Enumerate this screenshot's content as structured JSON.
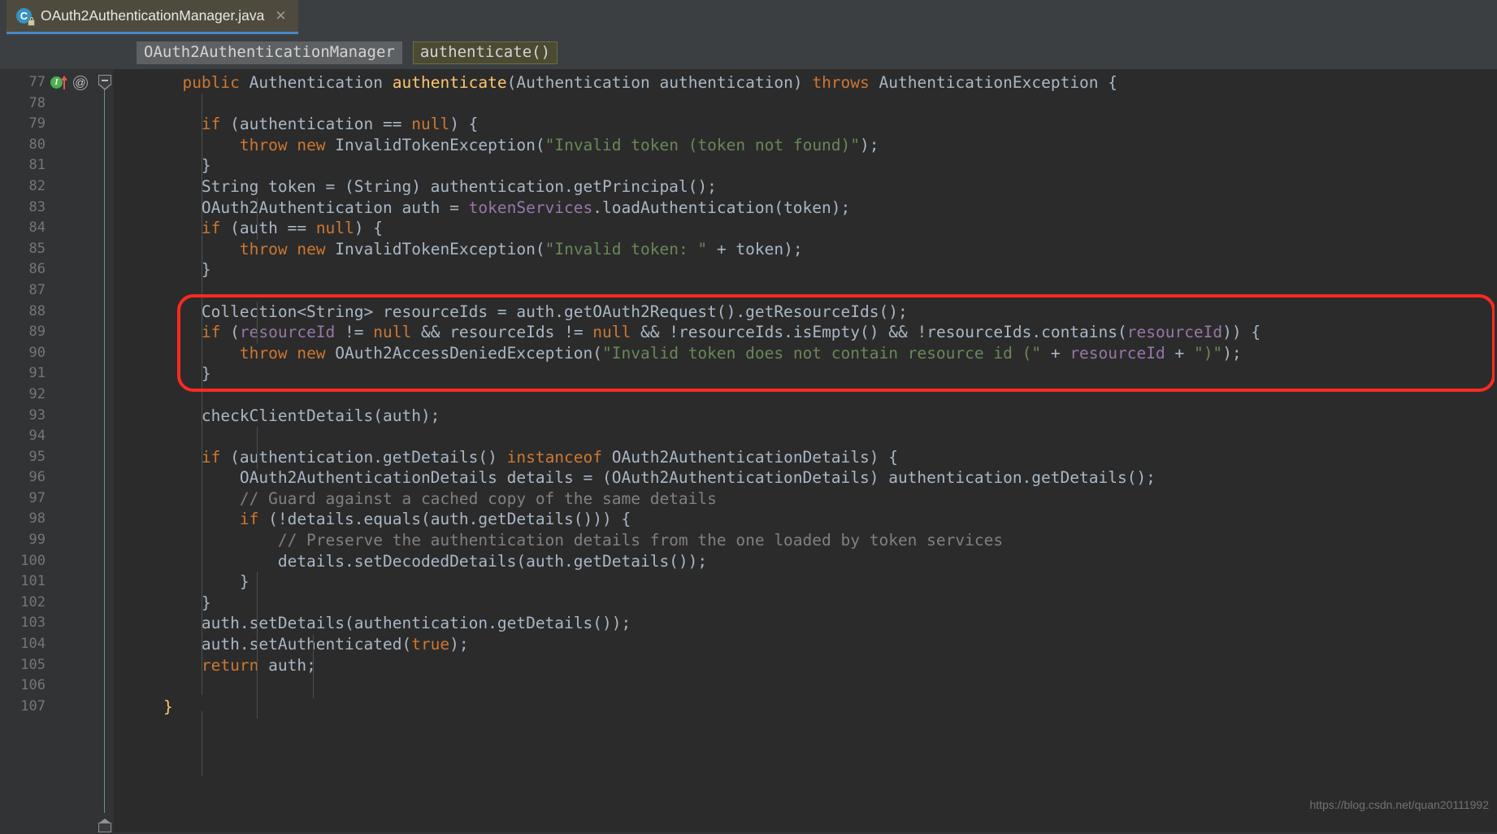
{
  "tab": {
    "title": "OAuth2AuthenticationManager.java",
    "icon": "java-class-icon",
    "lock_icon": "lock-icon",
    "close_label": "✕"
  },
  "breadcrumbs": [
    {
      "label": "OAuth2AuthenticationManager"
    },
    {
      "label": "authenticate()"
    }
  ],
  "gutter": {
    "icons": [
      {
        "name": "implemented-method-icon",
        "label": "I"
      },
      {
        "name": "overriding-method-arrow-icon",
        "label": ""
      },
      {
        "name": "annotation-at-icon",
        "label": "@"
      }
    ],
    "line_numbers": [
      "77",
      "78",
      "79",
      "80",
      "81",
      "82",
      "83",
      "84",
      "85",
      "86",
      "87",
      "88",
      "89",
      "90",
      "91",
      "92",
      "93",
      "94",
      "95",
      "96",
      "97",
      "98",
      "99",
      "100",
      "101",
      "102",
      "103",
      "104",
      "105",
      "106",
      "107"
    ]
  },
  "intention_bulb": {
    "name": "intention-lightbulb-icon"
  },
  "annotation": {
    "type": "red-rounded-rectangle",
    "color": "#fa2a21",
    "covers_lines": [
      "88",
      "89",
      "90",
      "91"
    ]
  },
  "code": {
    "language": "java",
    "lines": [
      {
        "n": "77",
        "tokens": [
          {
            "t": "      ",
            "c": "id"
          },
          {
            "t": "public",
            "c": "kw"
          },
          {
            "t": " Authentication ",
            "c": "id"
          },
          {
            "t": "authenticate",
            "c": "mth"
          },
          {
            "t": "(Authentication authentication) ",
            "c": "id"
          },
          {
            "t": "throws",
            "c": "kw"
          },
          {
            "t": " AuthenticationException {",
            "c": "id"
          }
        ]
      },
      {
        "n": "78",
        "tokens": []
      },
      {
        "n": "79",
        "tokens": [
          {
            "t": "        ",
            "c": "id"
          },
          {
            "t": "if",
            "c": "kw"
          },
          {
            "t": " (authentication == ",
            "c": "id"
          },
          {
            "t": "null",
            "c": "kw"
          },
          {
            "t": ") {",
            "c": "id"
          }
        ]
      },
      {
        "n": "80",
        "tokens": [
          {
            "t": "            ",
            "c": "id"
          },
          {
            "t": "throw new",
            "c": "kw"
          },
          {
            "t": " InvalidTokenException(",
            "c": "id"
          },
          {
            "t": "\"Invalid token (token not found)\"",
            "c": "str"
          },
          {
            "t": ");",
            "c": "id"
          }
        ]
      },
      {
        "n": "81",
        "tokens": [
          {
            "t": "        }",
            "c": "id"
          }
        ]
      },
      {
        "n": "82",
        "tokens": [
          {
            "t": "        String token = (String) authentication.getPrincipal();",
            "c": "id"
          }
        ]
      },
      {
        "n": "83",
        "tokens": [
          {
            "t": "        OAuth2Authentication auth = ",
            "c": "id"
          },
          {
            "t": "tokenServices",
            "c": "fld"
          },
          {
            "t": ".loadAuthentication(token);",
            "c": "id"
          }
        ]
      },
      {
        "n": "84",
        "tokens": [
          {
            "t": "        ",
            "c": "id"
          },
          {
            "t": "if",
            "c": "kw"
          },
          {
            "t": " (auth == ",
            "c": "id"
          },
          {
            "t": "null",
            "c": "kw"
          },
          {
            "t": ") {",
            "c": "id"
          }
        ]
      },
      {
        "n": "85",
        "tokens": [
          {
            "t": "            ",
            "c": "id"
          },
          {
            "t": "throw new",
            "c": "kw"
          },
          {
            "t": " InvalidTokenException(",
            "c": "id"
          },
          {
            "t": "\"Invalid token: \"",
            "c": "str"
          },
          {
            "t": " + token);",
            "c": "id"
          }
        ]
      },
      {
        "n": "86",
        "tokens": [
          {
            "t": "        }",
            "c": "id"
          }
        ]
      },
      {
        "n": "87",
        "tokens": []
      },
      {
        "n": "88",
        "tokens": [
          {
            "t": "        Collection<String> resourceIds = auth.getOAuth2Request().getResourceIds();",
            "c": "id"
          }
        ]
      },
      {
        "n": "89",
        "tokens": [
          {
            "t": "        ",
            "c": "id"
          },
          {
            "t": "if",
            "c": "kw"
          },
          {
            "t": " (",
            "c": "id"
          },
          {
            "t": "resourceId",
            "c": "fld"
          },
          {
            "t": " != ",
            "c": "id"
          },
          {
            "t": "null",
            "c": "kw"
          },
          {
            "t": " && resourceIds != ",
            "c": "id"
          },
          {
            "t": "null",
            "c": "kw"
          },
          {
            "t": " && !resourceIds.isEmpty() && !resourceIds.contains(",
            "c": "id"
          },
          {
            "t": "resourceId",
            "c": "fld"
          },
          {
            "t": ")) {",
            "c": "id"
          }
        ]
      },
      {
        "n": "90",
        "tokens": [
          {
            "t": "            ",
            "c": "id"
          },
          {
            "t": "throw new",
            "c": "kw"
          },
          {
            "t": " OAuth2AccessDeniedException(",
            "c": "id"
          },
          {
            "t": "\"Invalid token does not contain resource id (\"",
            "c": "str"
          },
          {
            "t": " + ",
            "c": "id"
          },
          {
            "t": "resourceId",
            "c": "fld"
          },
          {
            "t": " + ",
            "c": "id"
          },
          {
            "t": "\")\"",
            "c": "str"
          },
          {
            "t": ");",
            "c": "id"
          }
        ]
      },
      {
        "n": "91",
        "tokens": [
          {
            "t": "        }",
            "c": "id"
          }
        ]
      },
      {
        "n": "92",
        "tokens": []
      },
      {
        "n": "93",
        "tokens": [
          {
            "t": "        checkClientDetails(auth);",
            "c": "id"
          }
        ]
      },
      {
        "n": "94",
        "tokens": []
      },
      {
        "n": "95",
        "tokens": [
          {
            "t": "        ",
            "c": "id"
          },
          {
            "t": "if",
            "c": "kw"
          },
          {
            "t": " (authentication.getDetails() ",
            "c": "id"
          },
          {
            "t": "instanceof",
            "c": "kw"
          },
          {
            "t": " OAuth2AuthenticationDetails) {",
            "c": "id"
          }
        ]
      },
      {
        "n": "96",
        "tokens": [
          {
            "t": "            OAuth2AuthenticationDetails details = (OAuth2AuthenticationDetails) authentication.getDetails();",
            "c": "id"
          }
        ]
      },
      {
        "n": "97",
        "tokens": [
          {
            "t": "            // Guard against a cached copy of the same details",
            "c": "cmt"
          }
        ]
      },
      {
        "n": "98",
        "tokens": [
          {
            "t": "            ",
            "c": "id"
          },
          {
            "t": "if",
            "c": "kw"
          },
          {
            "t": " (!details.equals(auth.getDetails())) {",
            "c": "id"
          }
        ]
      },
      {
        "n": "99",
        "tokens": [
          {
            "t": "                // Preserve the authentication details from the one loaded by token services",
            "c": "cmt"
          }
        ]
      },
      {
        "n": "100",
        "tokens": [
          {
            "t": "                details.setDecodedDetails(auth.getDetails());",
            "c": "id"
          }
        ]
      },
      {
        "n": "101",
        "tokens": [
          {
            "t": "            }",
            "c": "id"
          }
        ]
      },
      {
        "n": "102",
        "tokens": [
          {
            "t": "        }",
            "c": "id"
          }
        ]
      },
      {
        "n": "103",
        "tokens": [
          {
            "t": "        auth.setDetails(authentication.getDetails());",
            "c": "id"
          }
        ]
      },
      {
        "n": "104",
        "tokens": [
          {
            "t": "        auth.setAuthenticated(",
            "c": "id"
          },
          {
            "t": "true",
            "c": "kw"
          },
          {
            "t": ");",
            "c": "id"
          }
        ]
      },
      {
        "n": "105",
        "tokens": [
          {
            "t": "        ",
            "c": "id"
          },
          {
            "t": "return",
            "c": "kw"
          },
          {
            "t": " auth;",
            "c": "id"
          }
        ]
      },
      {
        "n": "106",
        "tokens": []
      },
      {
        "n": "107",
        "tokens": [
          {
            "t": "    }",
            "c": "mth"
          }
        ]
      }
    ]
  },
  "watermark": {
    "text": "https://blog.csdn.net/quan20111992"
  },
  "colors": {
    "editor_background": "#2b2b2b",
    "gutter_background": "#313335",
    "tab_background": "#4e4a3e",
    "tab_underline": "#4a88c7",
    "keyword": "#cc7832",
    "string": "#6a8759",
    "method": "#ffc66d",
    "field": "#9876aa",
    "comment": "#808080",
    "identifier": "#a9b7c6",
    "annotation_box": "#fa2a21"
  }
}
